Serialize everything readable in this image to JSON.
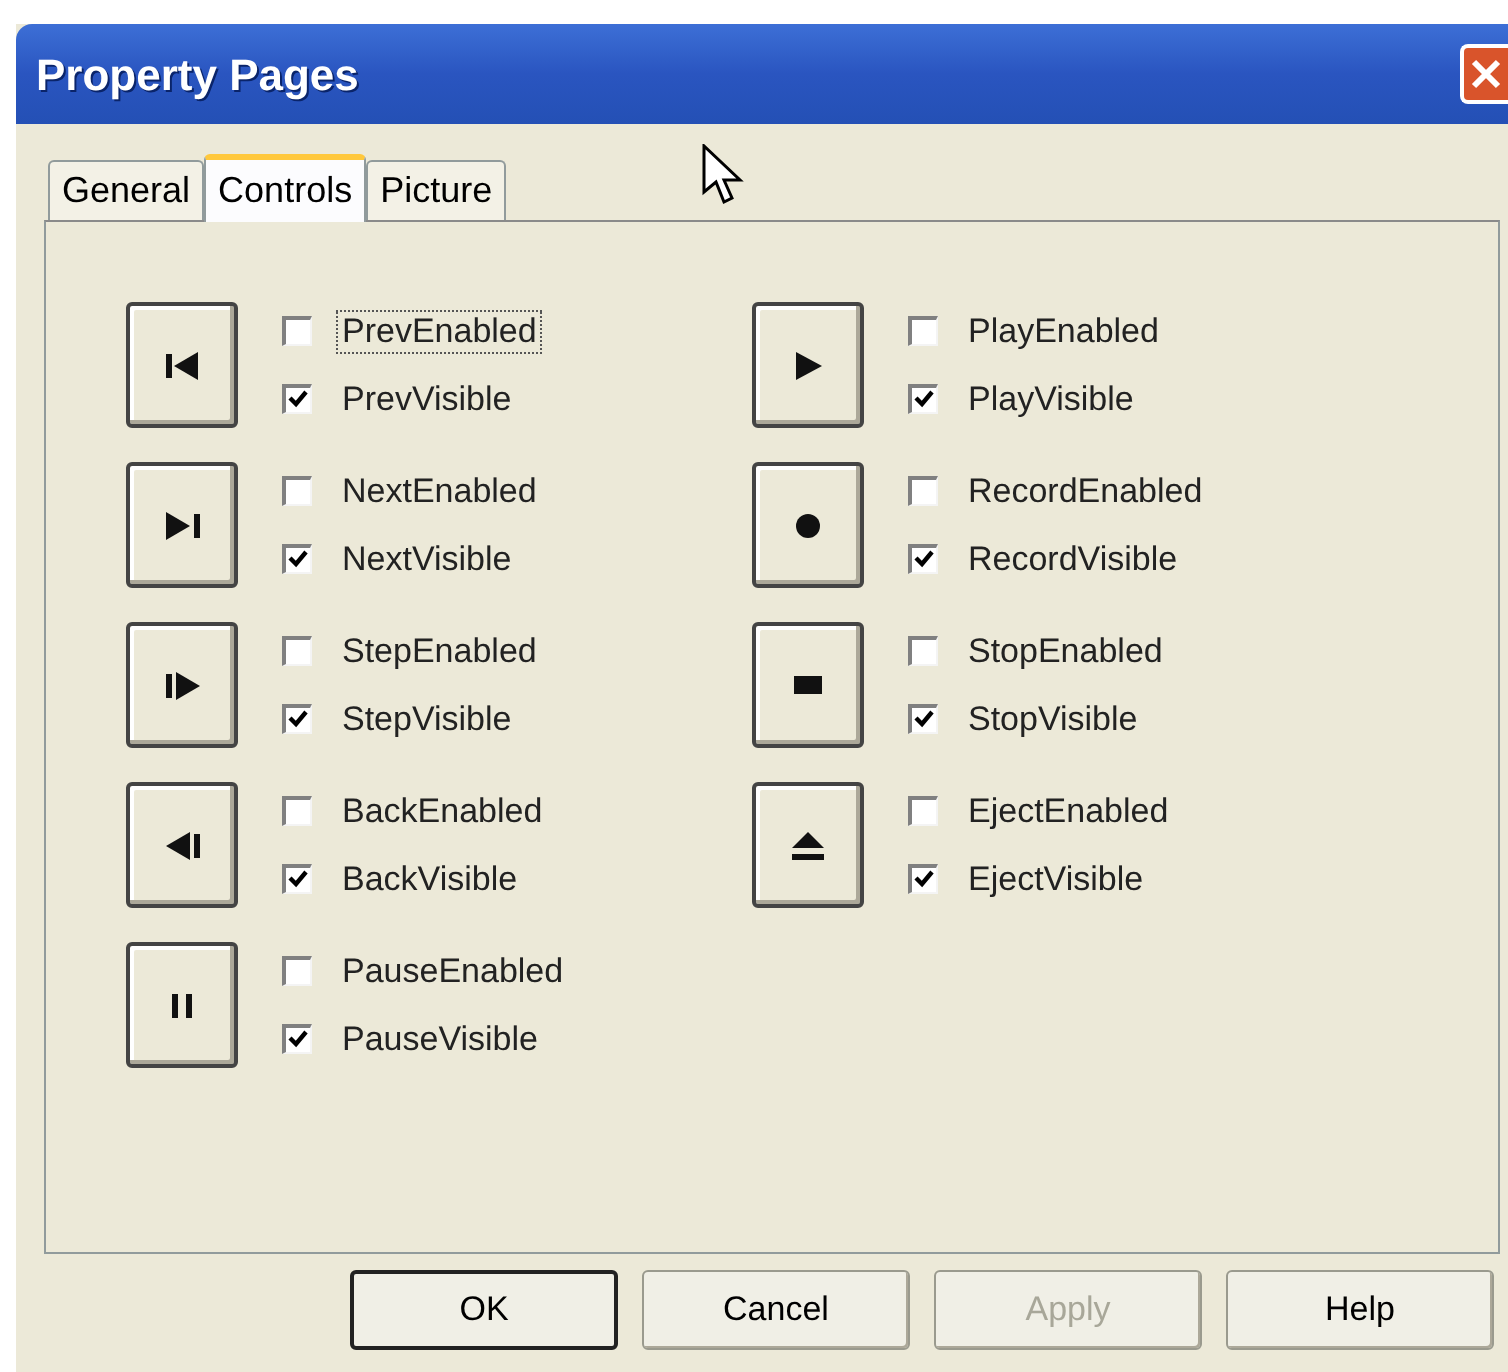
{
  "window": {
    "title": "Property Pages"
  },
  "tabs": [
    {
      "label": "General",
      "selected": false
    },
    {
      "label": "Controls",
      "selected": true
    },
    {
      "label": "Picture",
      "selected": false
    }
  ],
  "columns": [
    [
      {
        "kind": "prev",
        "options": [
          {
            "label": "PrevEnabled",
            "checked": false,
            "focused": true
          },
          {
            "label": "PrevVisible",
            "checked": true,
            "focused": false
          }
        ]
      },
      {
        "kind": "next",
        "options": [
          {
            "label": "NextEnabled",
            "checked": false,
            "focused": false
          },
          {
            "label": "NextVisible",
            "checked": true,
            "focused": false
          }
        ]
      },
      {
        "kind": "step",
        "options": [
          {
            "label": "StepEnabled",
            "checked": false,
            "focused": false
          },
          {
            "label": "StepVisible",
            "checked": true,
            "focused": false
          }
        ]
      },
      {
        "kind": "back",
        "options": [
          {
            "label": "BackEnabled",
            "checked": false,
            "focused": false
          },
          {
            "label": "BackVisible",
            "checked": true,
            "focused": false
          }
        ]
      },
      {
        "kind": "pause",
        "options": [
          {
            "label": "PauseEnabled",
            "checked": false,
            "focused": false
          },
          {
            "label": "PauseVisible",
            "checked": true,
            "focused": false
          }
        ]
      }
    ],
    [
      {
        "kind": "play",
        "options": [
          {
            "label": "PlayEnabled",
            "checked": false,
            "focused": false
          },
          {
            "label": "PlayVisible",
            "checked": true,
            "focused": false
          }
        ]
      },
      {
        "kind": "record",
        "options": [
          {
            "label": "RecordEnabled",
            "checked": false,
            "focused": false
          },
          {
            "label": "RecordVisible",
            "checked": true,
            "focused": false
          }
        ]
      },
      {
        "kind": "stop",
        "options": [
          {
            "label": "StopEnabled",
            "checked": false,
            "focused": false
          },
          {
            "label": "StopVisible",
            "checked": true,
            "focused": false
          }
        ]
      },
      {
        "kind": "eject",
        "options": [
          {
            "label": "EjectEnabled",
            "checked": false,
            "focused": false
          },
          {
            "label": "EjectVisible",
            "checked": true,
            "focused": false
          }
        ]
      }
    ]
  ],
  "buttons": [
    {
      "label": "OK",
      "default": true,
      "disabled": false
    },
    {
      "label": "Cancel",
      "default": false,
      "disabled": false
    },
    {
      "label": "Apply",
      "default": false,
      "disabled": true
    },
    {
      "label": "Help",
      "default": false,
      "disabled": false
    }
  ]
}
